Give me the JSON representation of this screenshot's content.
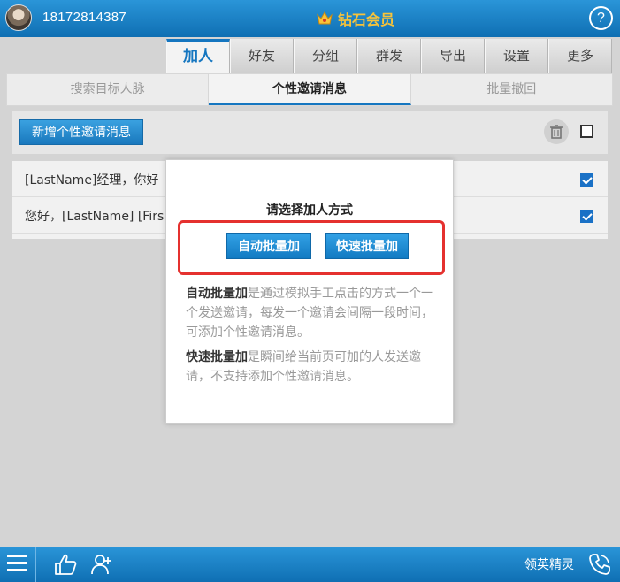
{
  "header": {
    "phone": "18172814387",
    "vip_label": "钻石会员",
    "help_label": "?"
  },
  "tabs": [
    {
      "label": "加人",
      "active": true
    },
    {
      "label": "好友"
    },
    {
      "label": "分组"
    },
    {
      "label": "群发"
    },
    {
      "label": "导出"
    },
    {
      "label": "设置"
    },
    {
      "label": "更多"
    }
  ],
  "subtabs": [
    {
      "label": "搜索目标人脉"
    },
    {
      "label": "个性邀请消息",
      "active": true
    },
    {
      "label": "批量撤回"
    }
  ],
  "panel": {
    "add_label": "新增个性邀请消息"
  },
  "messages": [
    {
      "text": "[LastName]经理，你好",
      "checked": true
    },
    {
      "text": "您好，[LastName] [Firs",
      "checked": true
    }
  ],
  "modal": {
    "title": "请选择加人方式",
    "auto_label": "自动批量加",
    "fast_label": "快速批量加",
    "desc1_bold": "自动批量加",
    "desc1_rest": "是通过模拟手工点击的方式一个一个发送邀请，每发一个邀请会间隔一段时间，可添加个性邀请消息。",
    "desc2_bold": "快速批量加",
    "desc2_rest": "是瞬间给当前页可加的人发送邀请，不支持添加个性邀请消息。"
  },
  "footer": {
    "brand": "领英精灵"
  },
  "colors": {
    "accent": "#1576c0",
    "vip_gold": "#f7c33a",
    "highlight_red": "#e5312f"
  }
}
